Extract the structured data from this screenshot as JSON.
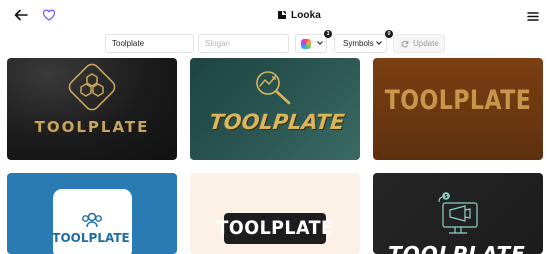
{
  "header": {
    "brand_name": "Looka"
  },
  "toolbar": {
    "name_value": "Toolplate",
    "slogan_placeholder": "Slogan",
    "colors_badge": "3",
    "symbols_label": "Symbols",
    "symbols_badge": "0",
    "update_label": "Update"
  },
  "logo_cards": [
    {
      "wordmark": "TOOLPLATE",
      "style": "dark-gold-hexagon",
      "background": "#1b1b1b",
      "accent": "#c9a45b"
    },
    {
      "wordmark": "TOOLPLATE",
      "style": "teal-gold-magnifier",
      "background": "#2c5753",
      "accent": "#d9b65e"
    },
    {
      "wordmark": "TOOLPLATE",
      "style": "brown-gold-text",
      "background": "#6b3711",
      "accent": "#c9954b"
    },
    {
      "wordmark": "TOOLPLATE",
      "style": "blue-white-tile",
      "background": "#2a7ab3",
      "accent": "#1f6da5"
    },
    {
      "wordmark": "TOOLPLATE",
      "style": "cream-black-plate",
      "background": "#fbf1e6",
      "accent": "#1d1d1d"
    },
    {
      "wordmark": "TOOLPLATE",
      "style": "dark-monitor-icon",
      "background": "#262626",
      "accent": "#8fd3c4"
    }
  ],
  "icons": {
    "back": "arrow-left-icon",
    "favorite": "heart-icon",
    "brand": "looka-logo-icon",
    "menu": "hamburger-menu-icon",
    "colors": "color-palette-icon",
    "refresh": "refresh-icon"
  },
  "colors": {
    "heart_accent": "#7b5cff",
    "text": "#111111"
  }
}
